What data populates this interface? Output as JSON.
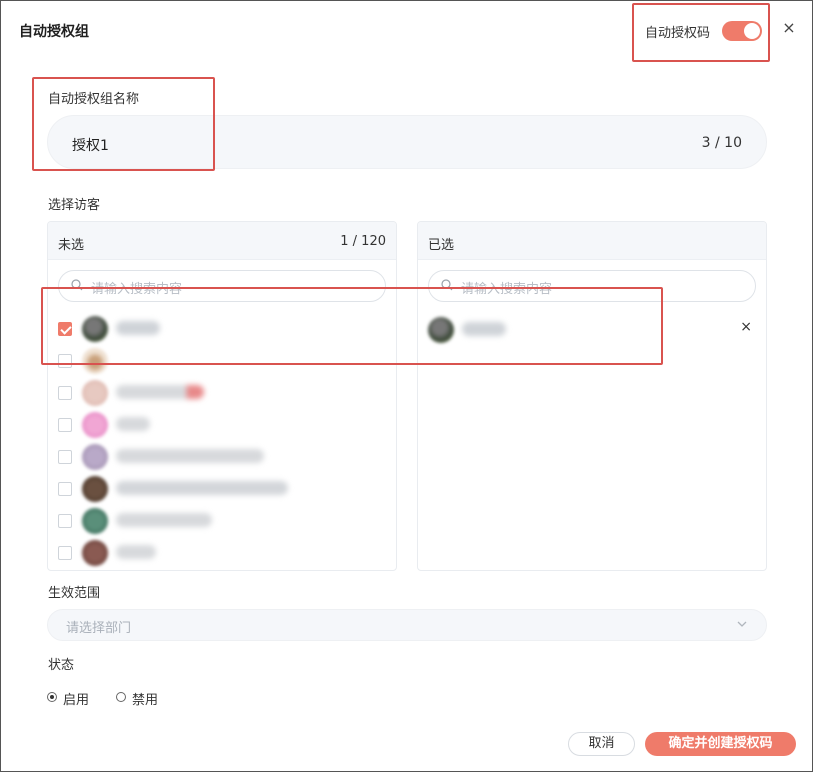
{
  "dialog": {
    "title": "自动授权组",
    "auto_code_label": "自动授权码",
    "auto_code_enabled": true,
    "close_glyph": "×"
  },
  "group_name": {
    "label": "自动授权组名称",
    "value": "授权1",
    "counter": "3 / 10"
  },
  "visitors": {
    "label": "选择访客",
    "unselected": {
      "title": "未选",
      "count": "1 / 120",
      "search_placeholder": "请输入搜索内容"
    },
    "selected": {
      "title": "已选",
      "search_placeholder": "请输入搜索内容",
      "remove_glyph": "×"
    }
  },
  "scope": {
    "label": "生效范围",
    "placeholder": "请选择部门"
  },
  "status": {
    "label": "状态",
    "options": [
      "启用",
      "禁用"
    ],
    "selected": "启用"
  },
  "footer": {
    "cancel": "取消",
    "confirm": "确定并创建授权码"
  },
  "colors": {
    "accent": "#ef7b6a",
    "highlight_border": "#d9534f"
  },
  "icons": {
    "search": "search-icon",
    "chevron": "chevron-down-icon",
    "close": "close-icon"
  }
}
